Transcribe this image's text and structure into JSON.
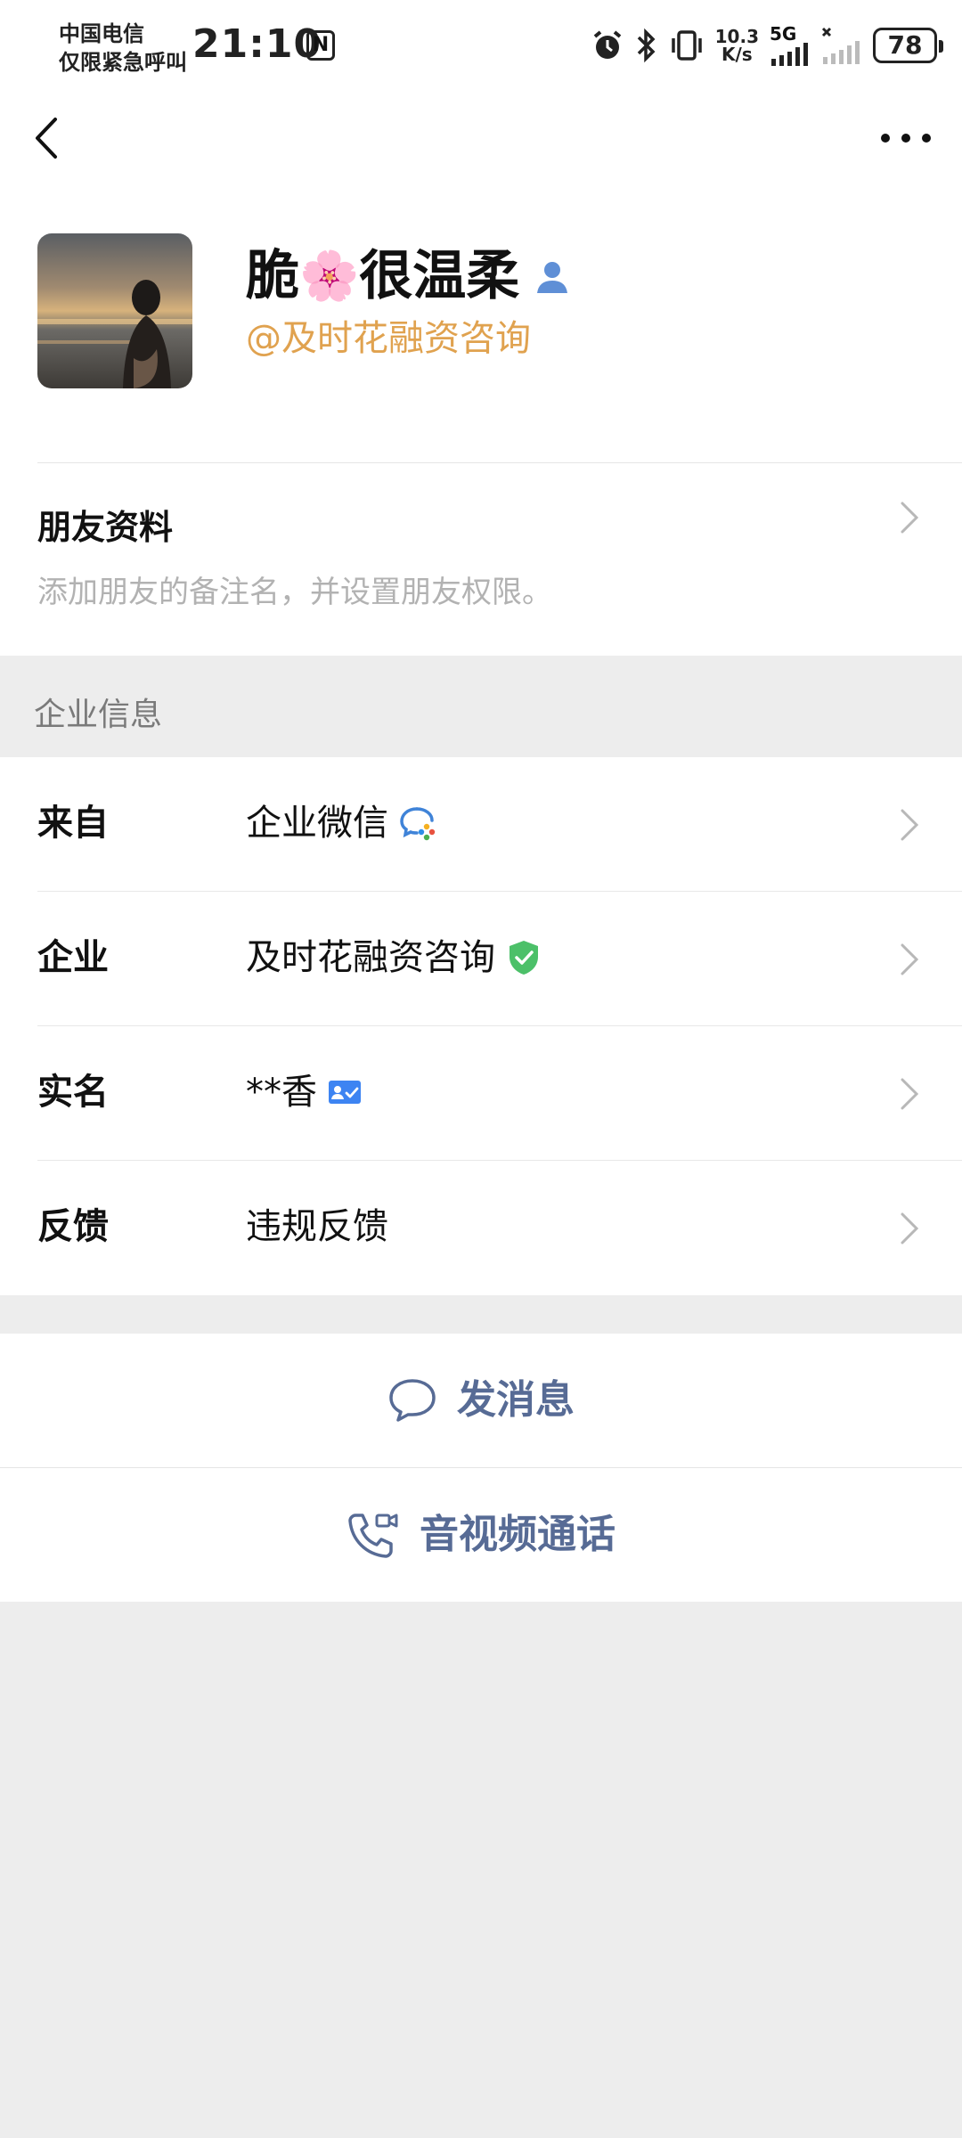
{
  "status_bar": {
    "carrier_line1": "中国电信",
    "carrier_line2": "仅限紧急呼叫",
    "time": "21:10",
    "nfc": "N",
    "net_speed_value": "10.3",
    "net_speed_unit": "K/s",
    "network": "5G",
    "battery": "78"
  },
  "profile": {
    "name_part1": "脆",
    "name_emoji": "🌸",
    "name_part2": "很温柔",
    "corp_tag": "@及时花融资咨询"
  },
  "friend_info": {
    "title": "朋友资料",
    "description": "添加朋友的备注名，并设置朋友权限。"
  },
  "enterprise": {
    "header": "企业信息",
    "rows": [
      {
        "label": "来自",
        "value": "企业微信",
        "icon": "wecom-icon"
      },
      {
        "label": "企业",
        "value": "及时花融资咨询",
        "icon": "verified-shield-icon"
      },
      {
        "label": "实名",
        "value": "**香",
        "icon": "id-card-verified-icon"
      },
      {
        "label": "反馈",
        "value": "违规反馈",
        "icon": ""
      }
    ]
  },
  "actions": {
    "send_message": "发消息",
    "av_call": "音视频通话"
  },
  "colors": {
    "corp_tag": "#e0a24f",
    "action_text": "#576b95",
    "verified_green": "#4cc069",
    "id_blue": "#3d84f2",
    "background": "#ededed"
  }
}
